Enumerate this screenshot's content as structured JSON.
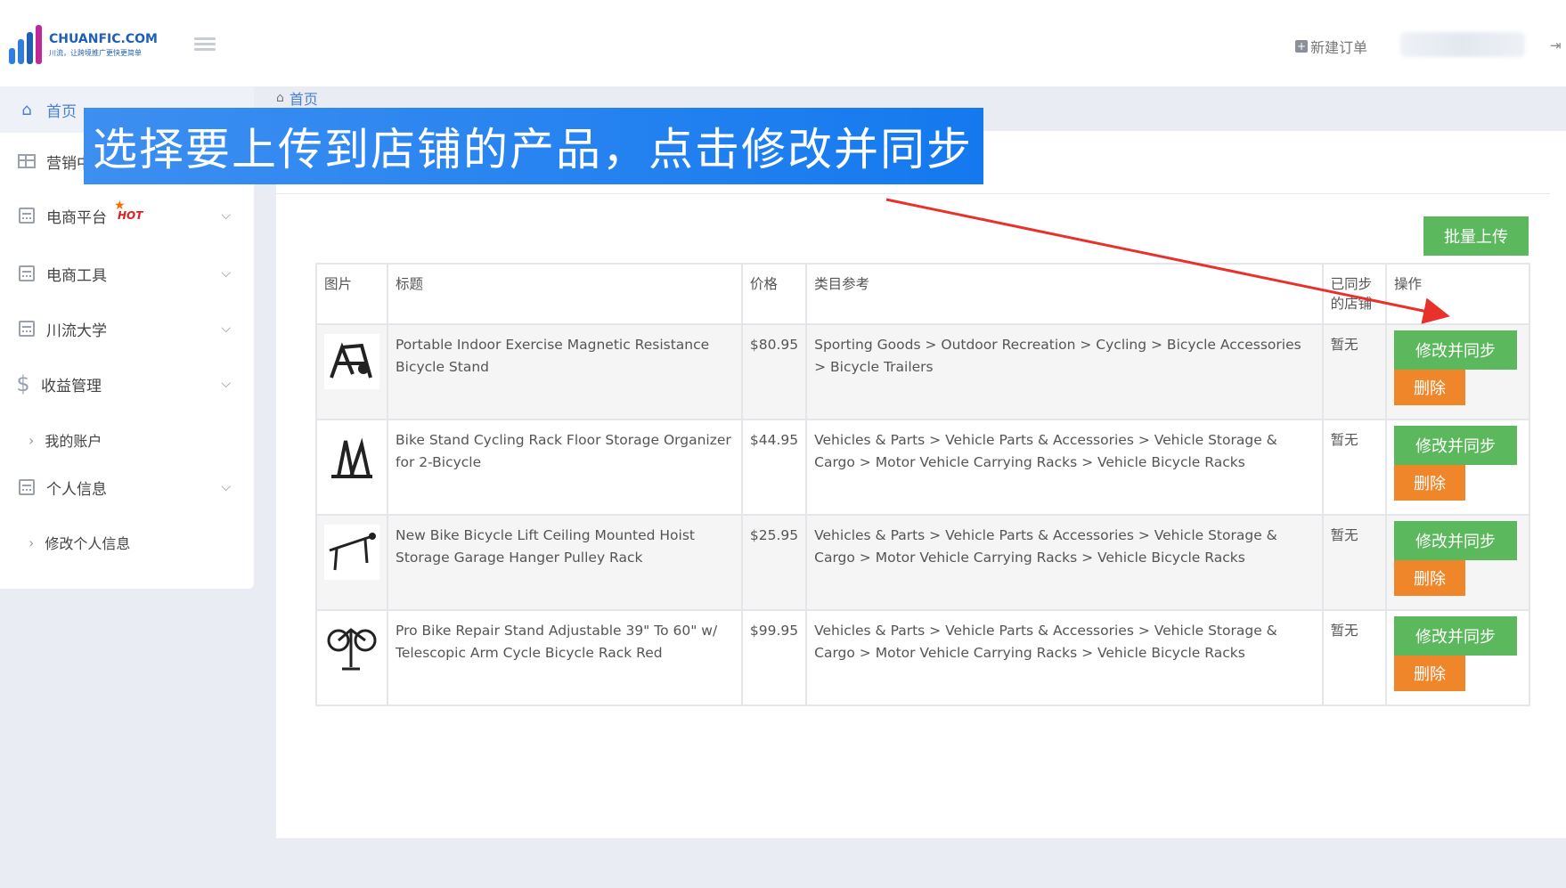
{
  "header": {
    "logo_title": "CHUANFIC.COM",
    "logo_subtitle": "川流，让跨境推广更快更简单",
    "new_order_label": "新建订单"
  },
  "sidebar": {
    "items": [
      {
        "label": "首页",
        "icon": "home-icon"
      },
      {
        "label": "营销中",
        "icon": "table-icon"
      },
      {
        "label": "电商平台",
        "icon": "calendar-icon",
        "badge": "HOT"
      },
      {
        "label": "电商工具",
        "icon": "calendar-icon"
      },
      {
        "label": "川流大学",
        "icon": "calendar-icon"
      },
      {
        "label": "收益管理",
        "icon": "dollar-icon"
      },
      {
        "label": "我的账户"
      },
      {
        "label": "个人信息",
        "icon": "calendar-icon"
      },
      {
        "label": "修改个人信息"
      }
    ]
  },
  "breadcrumb": {
    "label": "首页"
  },
  "banner": {
    "text": "选择要上传到店铺的产品，点击修改并同步"
  },
  "bulk_upload_label": "批量上传",
  "table": {
    "headers": [
      "图片",
      "标题",
      "价格",
      "类目参考",
      "已同步的店铺",
      "操作"
    ],
    "rows": [
      {
        "title": "Portable Indoor Exercise Magnetic Resistance Bicycle Stand",
        "price": "$80.95",
        "category": "Sporting Goods > Outdoor Recreation > Cycling > Bicycle Accessories > Bicycle Trailers",
        "synced": "暂无",
        "sync_label": "修改并同步",
        "delete_label": "删除"
      },
      {
        "title": "Bike Stand Cycling Rack Floor Storage Organizer for 2-Bicycle",
        "price": "$44.95",
        "category": "Vehicles & Parts > Vehicle Parts & Accessories > Vehicle Storage & Cargo > Motor Vehicle Carrying Racks > Vehicle Bicycle Racks",
        "synced": "暂无",
        "sync_label": "修改并同步",
        "delete_label": "删除"
      },
      {
        "title": "New Bike Bicycle Lift Ceiling Mounted Hoist Storage Garage Hanger Pulley Rack",
        "price": "$25.95",
        "category": "Vehicles & Parts > Vehicle Parts & Accessories > Vehicle Storage & Cargo > Motor Vehicle Carrying Racks > Vehicle Bicycle Racks",
        "synced": "暂无",
        "sync_label": "修改并同步",
        "delete_label": "删除"
      },
      {
        "title": "Pro Bike Repair Stand Adjustable 39\" To 60\" w/ Telescopic Arm Cycle Bicycle Rack Red",
        "price": "$99.95",
        "category": "Vehicles & Parts > Vehicle Parts & Accessories > Vehicle Storage & Cargo > Motor Vehicle Carrying Racks > Vehicle Bicycle Racks",
        "synced": "暂无",
        "sync_label": "修改并同步",
        "delete_label": "删除"
      }
    ]
  },
  "colors": {
    "primary_green": "#5cb85c",
    "delete_orange": "#f0862a",
    "banner_blue": "#1479ef",
    "link_blue": "#4a7fd1",
    "annotation_red": "#e8312b"
  }
}
